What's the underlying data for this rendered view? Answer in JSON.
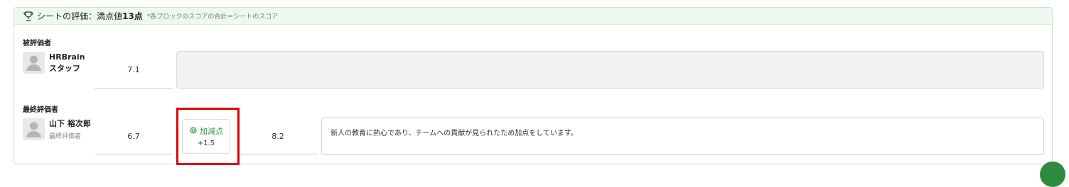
{
  "header": {
    "title": "シートの評価：満点値",
    "max_score": "13点",
    "note": "*各ブロックのスコアの合計＝シートのスコア",
    "icon": "trophy-icon"
  },
  "evaluatee": {
    "section_label": "被評価者",
    "name": "HRBrain スタッフ",
    "score": "7.1",
    "comment": ""
  },
  "final_evaluator": {
    "section_label": "最終評価者",
    "name": "山下 裕次郎",
    "role": "最終評価者",
    "score": "6.7",
    "adjustment": {
      "label": "加減点",
      "value": "+1.5",
      "icon": "gear-icon"
    },
    "total_score": "8.2",
    "comment": "新人の教育に熱心であり、チームへの貢献が見られたため加点をしています。"
  },
  "colors": {
    "header_bg": "#eef8ee",
    "accent_green": "#2e9a3b",
    "highlight_red": "#e00000"
  }
}
